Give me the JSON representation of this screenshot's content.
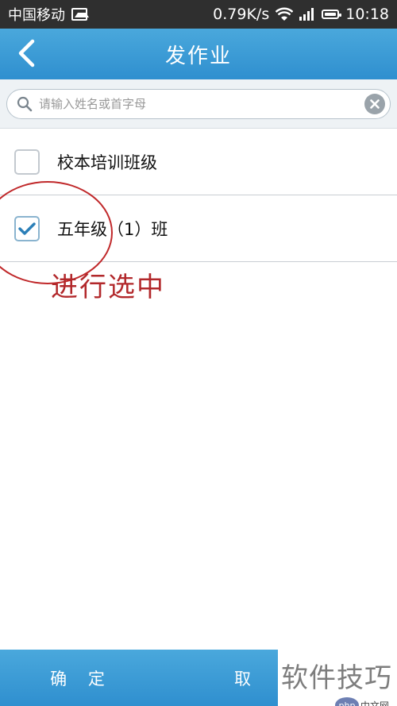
{
  "status_bar": {
    "carrier": "中国移动",
    "speed": "0.79K/s",
    "time": "10:18",
    "icons": [
      "image-icon",
      "wifi-icon",
      "signal-icon",
      "battery-icon"
    ]
  },
  "header": {
    "title": "发作业",
    "back_icon": "chevron-left-icon"
  },
  "search": {
    "placeholder": "请输入姓名或首字母",
    "value": ""
  },
  "list": {
    "items": [
      {
        "label": "校本培训班级",
        "checked": false
      },
      {
        "label": "五年级（1）班",
        "checked": true
      }
    ]
  },
  "annotation": {
    "text": "进行选中"
  },
  "footer": {
    "confirm_label": "确 定",
    "cancel_label": "取"
  },
  "watermark": {
    "text": "软件技巧",
    "logo_php": "php",
    "logo_cn": "中文网"
  },
  "colors": {
    "accent": "#3a9ad6",
    "annotation": "#b2282b",
    "status_bar": "#2f2f2f"
  }
}
